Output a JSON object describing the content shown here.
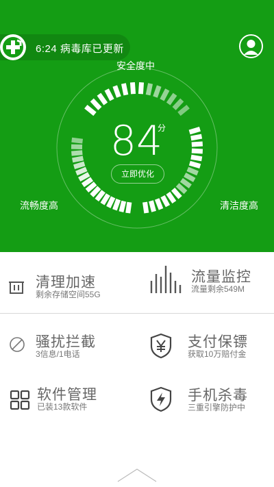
{
  "header": {
    "update_text": "6:24 病毒库已更新"
  },
  "gauge": {
    "top_label": "安全度中",
    "left_label": "流畅度高",
    "right_label": "清洁度高",
    "score": "84",
    "score_unit": "分",
    "optimize_label": "立即优化"
  },
  "features": [
    {
      "title": "清理加速",
      "subtitle": "剩余存储空间55G",
      "icon": "trash-icon"
    },
    {
      "title": "流量监控",
      "subtitle": "流量剩余549M",
      "icon": "traffic-bars-icon"
    },
    {
      "title": "骚扰拦截",
      "subtitle": "3信息/1电话",
      "icon": "block-icon"
    },
    {
      "title": "支付保镖",
      "subtitle": "获取10万赔付金",
      "icon": "yen-shield-icon"
    },
    {
      "title": "软件管理",
      "subtitle": "已装13款软件",
      "icon": "apps-grid-icon"
    },
    {
      "title": "手机杀毒",
      "subtitle": "三重引擎防护中",
      "icon": "lightning-shield-icon"
    }
  ],
  "colors": {
    "brand_green": "#149d14",
    "text_gray": "#666666"
  }
}
